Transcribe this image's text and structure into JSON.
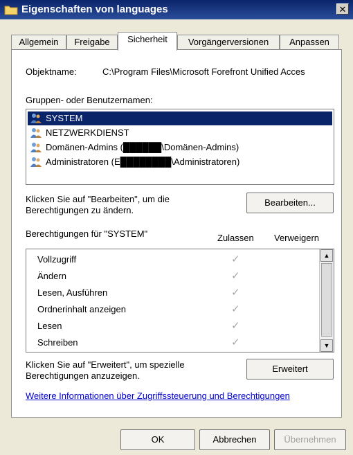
{
  "window": {
    "title": "Eigenschaften von languages",
    "close_glyph": "✕"
  },
  "tabs": [
    {
      "label": "Allgemein"
    },
    {
      "label": "Freigabe"
    },
    {
      "label": "Sicherheit",
      "active": true
    },
    {
      "label": "Vorgängerversionen"
    },
    {
      "label": "Anpassen"
    }
  ],
  "object": {
    "label": "Objektname:",
    "value": "C:\\Program Files\\Microsoft Forefront Unified Acces"
  },
  "groups": {
    "label": "Gruppen- oder Benutzernamen:",
    "items": [
      {
        "text": "SYSTEM",
        "selected": true,
        "icon": "users-icon"
      },
      {
        "text": "NETZWERKDIENST",
        "icon": "users-icon"
      },
      {
        "text": "Domänen-Admins (██████\\Domänen-Admins)",
        "icon": "users-icon"
      },
      {
        "text": "Administratoren (E████████\\Administratoren)",
        "icon": "users-icon"
      }
    ]
  },
  "edit": {
    "hint": [
      "Klicken Sie auf \"Bearbeiten\", um die",
      "Berechtigungen zu ändern."
    ],
    "button": "Bearbeiten..."
  },
  "permissions": {
    "label": "Berechtigungen für \"SYSTEM\"",
    "allow_header": "Zulassen",
    "deny_header": "Verweigern",
    "rows": [
      {
        "name": "Vollzugriff",
        "allow": "✓"
      },
      {
        "name": "Ändern",
        "allow": "✓"
      },
      {
        "name": "Lesen, Ausführen",
        "allow": "✓"
      },
      {
        "name": "Ordnerinhalt anzeigen",
        "allow": "✓"
      },
      {
        "name": "Lesen",
        "allow": "✓"
      },
      {
        "name": "Schreiben",
        "allow": "✓"
      }
    ]
  },
  "advanced": {
    "hint": [
      "Klicken Sie auf \"Erweitert\", um spezielle",
      "Berechtigungen anzuzeigen."
    ],
    "button": "Erweitert"
  },
  "link": "Weitere Informationen über Zugriffssteuerung und Berechtigungen",
  "footer": {
    "ok": "OK",
    "cancel": "Abbrechen",
    "apply": "Übernehmen"
  },
  "colors": {
    "title_bar": "#0a246a",
    "selection": "#0a246a",
    "link": "#0000cc"
  }
}
